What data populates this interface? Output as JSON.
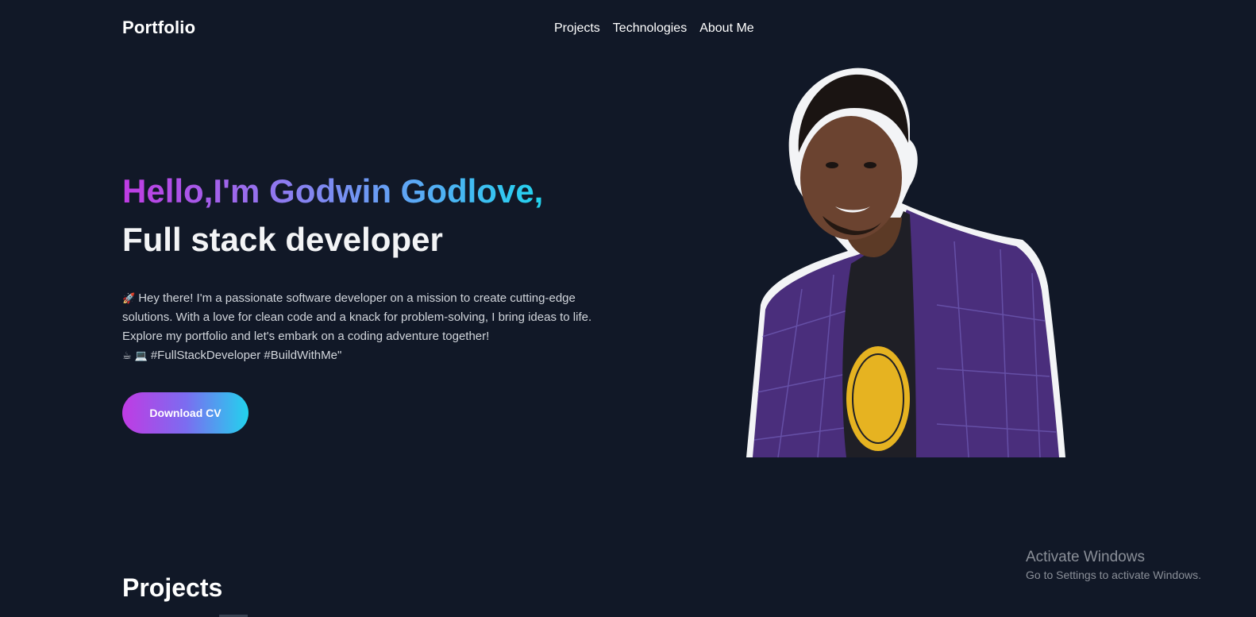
{
  "header": {
    "logo": "Portfolio",
    "nav": [
      "Projects",
      "Technologies",
      "About Me"
    ]
  },
  "hero": {
    "title": "Hello,I'm Godwin Godlove,",
    "subtitle": "Full stack developer",
    "description_lines": [
      "Hey there! I'm a passionate software developer on a mission to create cutting-edge",
      "solutions. With a love for clean code and a knack for problem-solving, I bring ideas to life.",
      "Explore my portfolio and let's embark on a coding adventure together!",
      "#FullStackDeveloper #BuildWithMe\""
    ],
    "emojis": {
      "rocket": "🚀",
      "coffee": "☕",
      "laptop": "💻"
    },
    "cta_label": "Download CV",
    "portrait_icon": "developer-portrait"
  },
  "projects": {
    "heading": "Projects"
  },
  "watermark": {
    "title": "Activate Windows",
    "subtitle": "Go to Settings to activate Windows."
  },
  "colors": {
    "background": "#111827",
    "gradient_start": "#c03be3",
    "gradient_end": "#22d3ee"
  }
}
